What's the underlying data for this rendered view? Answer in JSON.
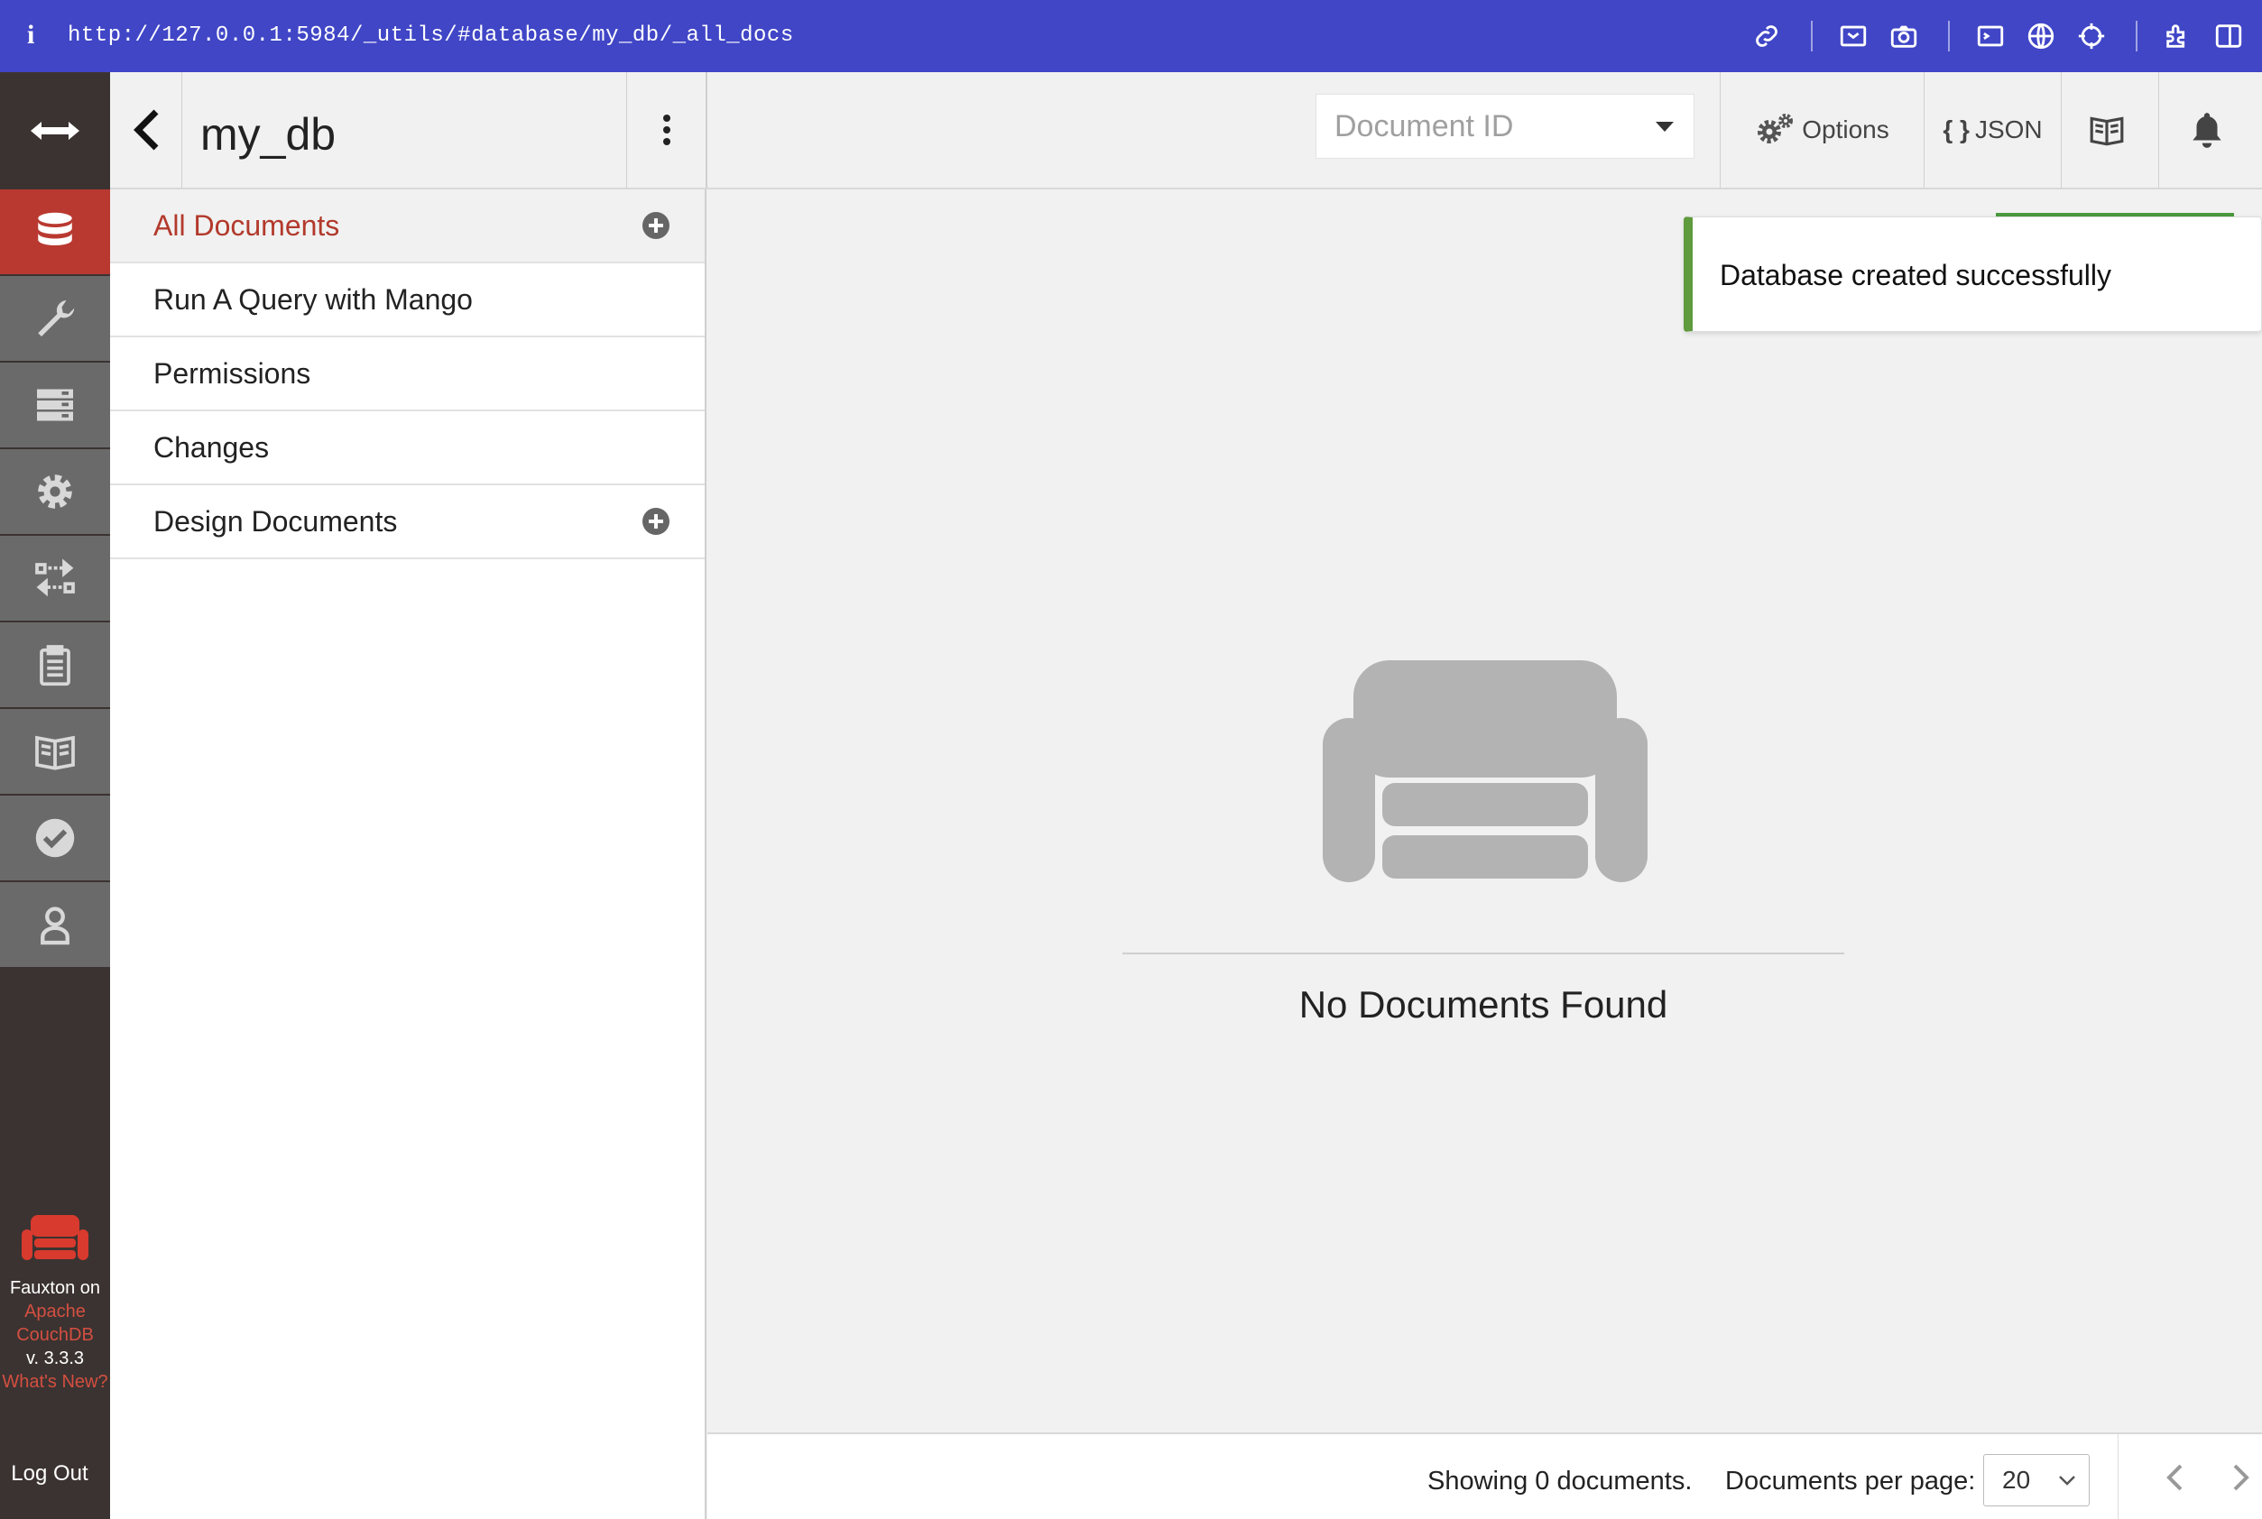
{
  "browser": {
    "info_icon": "i",
    "url": "http://127.0.0.1:5984/_utils/#database/my_db/_all_docs",
    "toolbar_icons": [
      "link-icon",
      "screenshot-area-icon",
      "camera-icon",
      "terminal-icon",
      "globe-icon",
      "crosshair-icon",
      "extensions-icon",
      "sidebar-toggle-icon"
    ]
  },
  "nav": {
    "expand_icon": "double-arrow-icon",
    "items": [
      {
        "name": "databases",
        "icon": "database-icon",
        "active": true
      },
      {
        "name": "setup",
        "icon": "wrench-icon"
      },
      {
        "name": "active-tasks",
        "icon": "server-icon"
      },
      {
        "name": "config",
        "icon": "gear-icon"
      },
      {
        "name": "replication",
        "icon": "replication-icon"
      },
      {
        "name": "clipboard",
        "icon": "clipboard-icon"
      },
      {
        "name": "docs",
        "icon": "book-icon"
      },
      {
        "name": "verify",
        "icon": "check-circle-icon"
      },
      {
        "name": "user",
        "icon": "user-icon"
      }
    ],
    "brand_line1": "Fauxton on",
    "brand_line2": "Apache",
    "brand_line3": "CouchDB",
    "version": "v. 3.3.3",
    "whats_new": "What's New?",
    "logout": "Log Out"
  },
  "header": {
    "db_name": "my_db",
    "doc_id_placeholder": "Document ID",
    "options_label": "Options",
    "json_label": "JSON",
    "json_brace": "{ }"
  },
  "sidebar": {
    "items": [
      {
        "label": "All Documents",
        "active": true,
        "has_add": true
      },
      {
        "label": "Run A Query with Mango"
      },
      {
        "label": "Permissions"
      },
      {
        "label": "Changes"
      },
      {
        "label": "Design Documents",
        "has_add": true
      }
    ]
  },
  "main": {
    "toast": "Database created successfully",
    "empty_message": "No Documents Found"
  },
  "footer": {
    "showing": "Showing 0 documents.",
    "per_page_label": "Documents per page:",
    "per_page_value": "20"
  },
  "colors": {
    "url_bar": "#4046c6",
    "nav_bg": "#3b3331",
    "nav_active": "#b93930",
    "active_link": "#b23a2c",
    "toast_accent": "#5f9a3d"
  }
}
